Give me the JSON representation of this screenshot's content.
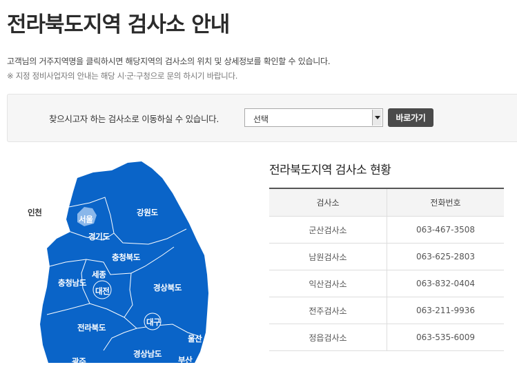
{
  "page": {
    "title": "전라북도지역 검사소 안내",
    "intro_line1": "고객님의 거주지역명을 클릭하시면 해당지역의 검사소의 위치 및 상세정보를 확인할 수 있습니다.",
    "intro_line2": "※ 지정 정비사업자의 안내는 해당 시·군·구청으로 문의 하시기 바랍니다."
  },
  "search": {
    "label": "찾으시고자 하는 검사소로 이동하실 수 있습니다.",
    "selected": "선택",
    "go_label": "바로가기"
  },
  "map": {
    "fill_color": "#0a64c8",
    "light_color": "#8ab7ea",
    "regions": {
      "incheon": "인천",
      "seoul": "서울",
      "gyeonggi": "경기도",
      "gangwon": "강원도",
      "chungbuk": "충청북도",
      "sejong": "세종",
      "chungnam": "충청남도",
      "daejeon": "대전",
      "gyeongbuk": "경상북도",
      "jeonbuk": "전라북도",
      "daegu": "대구",
      "ulsan": "울산",
      "gyeongnam": "경상남도",
      "gwangju": "광주",
      "busan": "부산"
    }
  },
  "status": {
    "title": "전라북도지역 검사소 현황",
    "columns": [
      "검사소",
      "전화번호"
    ],
    "rows": [
      {
        "name": "군산검사소",
        "phone": "063-467-3508"
      },
      {
        "name": "남원검사소",
        "phone": "063-625-2803"
      },
      {
        "name": "익산검사소",
        "phone": "063-832-0404"
      },
      {
        "name": "전주검사소",
        "phone": "063-211-9936"
      },
      {
        "name": "정읍검사소",
        "phone": "063-535-6009"
      }
    ]
  }
}
